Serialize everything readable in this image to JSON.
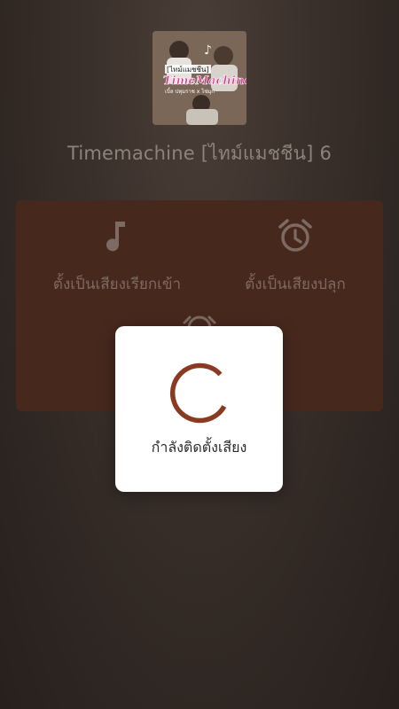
{
  "album": {
    "art_text_top": "[ไทม์แมชชีน]",
    "art_text_title": "TimeMachine",
    "art_text_sub": "เบิ้ล ปทุมราช x ไข่มุก"
  },
  "track": {
    "title": "Timemachine [ไทม์แมชชีน] 6"
  },
  "options": {
    "ringtone": {
      "label": "ตั้งเป็นเสียงเรียกเข้า",
      "icon": "music-note-icon"
    },
    "alarm": {
      "label": "ตั้งเป็นเสียงปลุก",
      "icon": "alarm-clock-icon"
    },
    "notification": {
      "label": "",
      "icon": "notification-icon"
    }
  },
  "dialog": {
    "message": "กำลังติดตั้งเสียง"
  },
  "colors": {
    "accent": "#8b3a22",
    "panel": "#47281d",
    "text_muted": "#8e837b"
  }
}
